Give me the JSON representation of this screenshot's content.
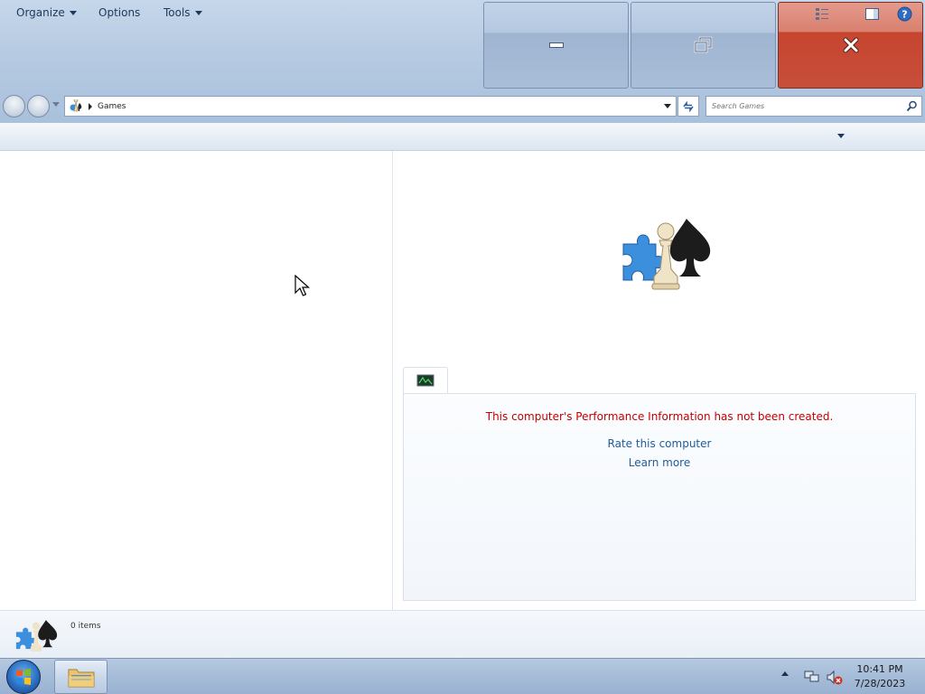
{
  "window": {
    "caption_buttons": [
      {
        "name": "minimize"
      },
      {
        "name": "restore"
      },
      {
        "name": "close"
      }
    ]
  },
  "address_bar": {
    "breadcrumb": "Games",
    "icon": "games-icon"
  },
  "search": {
    "placeholder": "Search Games"
  },
  "toolbar": {
    "organize_label": "Organize",
    "options_label": "Options",
    "tools_label": "Tools"
  },
  "performance": {
    "message": "This computer's Performance Information has not been created.",
    "rate_link": "Rate this computer",
    "learn_link": "Learn more",
    "message_color": "#c40000",
    "link_color": "#1f5d9b"
  },
  "details": {
    "item_count": "0 items"
  },
  "taskbar": {
    "time": "10:41 PM",
    "date": "7/28/2023"
  },
  "colors": {
    "close_button": "#c6452f",
    "frame": "#b7cbe2"
  }
}
